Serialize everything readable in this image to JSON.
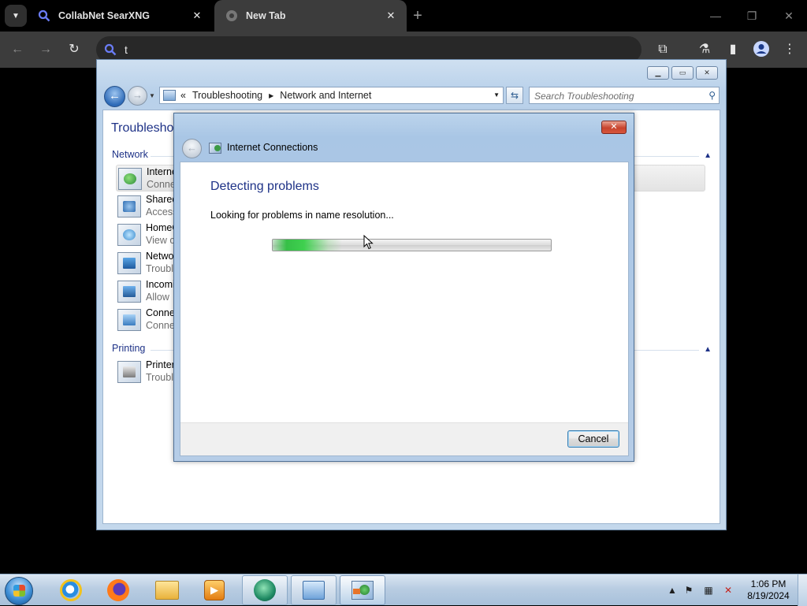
{
  "browser": {
    "tabs": [
      {
        "title": "CollabNet SearXNG"
      },
      {
        "title": "New Tab"
      }
    ],
    "omnibox_value": "t"
  },
  "explorer": {
    "breadcrumb": {
      "prefix": "«",
      "items": [
        "Troubleshooting",
        "Network and Internet"
      ]
    },
    "search_placeholder": "Search Troubleshooting",
    "page_title": "Troubleshoo",
    "groups": [
      {
        "label": "Network"
      },
      {
        "label": "Printing"
      }
    ],
    "items": [
      {
        "title": "Interne",
        "subtitle": "Conne"
      },
      {
        "title": "Shared",
        "subtitle": "Access"
      },
      {
        "title": "HomeG",
        "subtitle": "View c"
      },
      {
        "title": "Netwo",
        "subtitle": "Troubl"
      },
      {
        "title": "Incomi",
        "subtitle": "Allow"
      },
      {
        "title": "Conne",
        "subtitle": "Conne"
      },
      {
        "title": "Printer",
        "subtitle": "Troubl"
      }
    ]
  },
  "dialog": {
    "title": "Internet Connections",
    "heading": "Detecting problems",
    "status": "Looking for problems in name resolution...",
    "progress_fraction": 0.25,
    "cancel_label": "Cancel"
  },
  "taskbar": {
    "clock_time": "1:06 PM",
    "clock_date": "8/19/2024"
  },
  "colors": {
    "link_blue": "#1e3287",
    "progress_green": "#36c047",
    "close_red": "#c8442e"
  }
}
